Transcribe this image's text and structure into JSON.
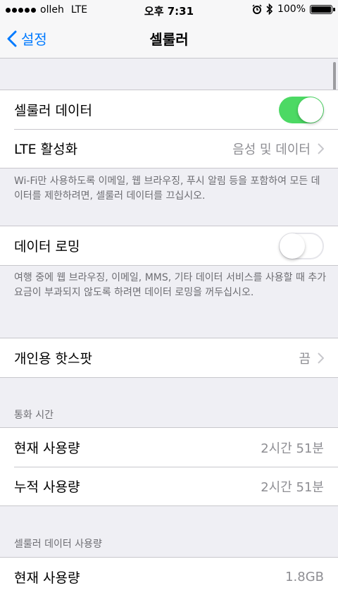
{
  "status_bar": {
    "carrier": "olleh",
    "network": "LTE",
    "time": "오후 7:31",
    "battery": "100%"
  },
  "nav": {
    "back_label": "설정",
    "title": "셀룰러"
  },
  "cellular_data": {
    "label": "셀룰러 데이터",
    "enabled": true,
    "accent": "#4cd964"
  },
  "lte": {
    "label": "LTE 활성화",
    "value": "음성 및 데이터"
  },
  "cellular_footer": "Wi-Fi만 사용하도록 이메일, 웹 브라우징, 푸시 알림 등을 포함하여 모든 데이터를 제한하려면, 셀룰러 데이터를 끄십시오.",
  "roaming": {
    "label": "데이터 로밍",
    "enabled": false
  },
  "roaming_footer": "여행 중에 웹 브라우징, 이메일, MMS, 기타 데이터 서비스를 사용할 때 추가 요금이 부과되지 않도록 하려면 데이터 로밍을 꺼두십시오.",
  "hotspot": {
    "label": "개인용 핫스팟",
    "value": "끔"
  },
  "call_time": {
    "header": "통화 시간",
    "current_label": "현재 사용량",
    "current_value": "2시간 51분",
    "total_label": "누적 사용량",
    "total_value": "2시간 51분"
  },
  "data_usage": {
    "header": "셀룰러 데이터 사용량",
    "current_label": "현재 사용량",
    "current_value": "1.8GB"
  },
  "colors": {
    "accent": "#007aff",
    "background": "#efeff4"
  }
}
